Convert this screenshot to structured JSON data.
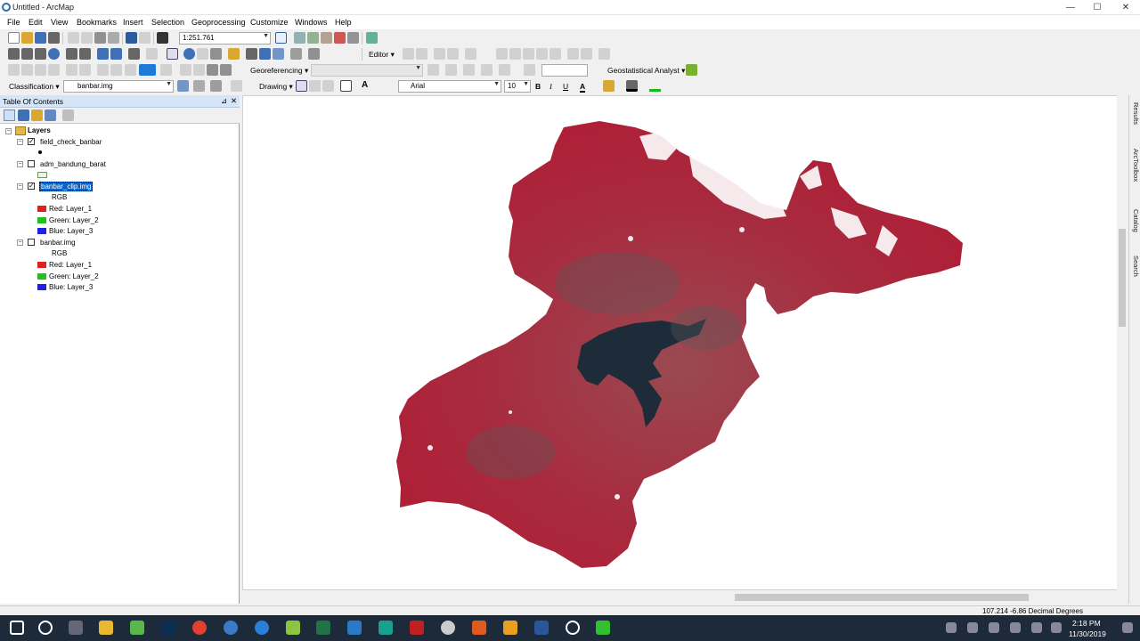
{
  "window": {
    "title": "Untitled - ArcMap",
    "min": "—",
    "max": "☐",
    "close": "✕"
  },
  "menu": [
    "File",
    "Edit",
    "View",
    "Bookmarks",
    "Insert",
    "Selection",
    "Geoprocessing",
    "Customize",
    "Windows",
    "Help"
  ],
  "toolbar1": {
    "scale": "1:251.761"
  },
  "toolbar2": {
    "georef_label": "Georeferencing ▾",
    "geostat_label": "Geostatistical Analyst ▾",
    "editor_label": "Editor ▾"
  },
  "toolbar3": {
    "classification_label": "Classification ▾",
    "layer_select": "banbar.img",
    "drawing_label": "Drawing ▾",
    "font": "Arial",
    "font_size": "10",
    "bold": "B",
    "italic": "I",
    "underline": "U",
    "font_color_glyph": "A"
  },
  "toc": {
    "title": "Table Of Contents",
    "pin": "⊿",
    "close": "✕",
    "root": "Layers",
    "layers": [
      {
        "name": "field_check_banbar",
        "checked": "✓"
      },
      {
        "name": "adm_bandung_barat",
        "checked": ""
      },
      {
        "name": "banbar_clip.img",
        "checked": "✓",
        "rgb": "RGB",
        "bands": [
          {
            "label": "Red:    Layer_1",
            "color": "#e02020"
          },
          {
            "label": "Green: Layer_2",
            "color": "#20c020"
          },
          {
            "label": "Blue:   Layer_3",
            "color": "#2020e0"
          }
        ]
      },
      {
        "name": "banbar.img",
        "checked": "",
        "rgb": "RGB",
        "bands": [
          {
            "label": "Red:    Layer_1",
            "color": "#e02020"
          },
          {
            "label": "Green: Layer_2",
            "color": "#20c020"
          },
          {
            "label": "Blue:   Layer_3",
            "color": "#2020e0"
          }
        ]
      }
    ]
  },
  "side_tabs": [
    "Results",
    "ArcToolbox",
    "Catalog",
    "Search"
  ],
  "status": {
    "coords": "107.214  -6.86 Decimal Degrees"
  },
  "taskbar": {
    "time": "2:18 PM",
    "date": "11/30/2019"
  },
  "colors": {
    "map_red": "#a8283c",
    "selection": "#0a64c8",
    "toc_header": "#d6e4f7"
  }
}
